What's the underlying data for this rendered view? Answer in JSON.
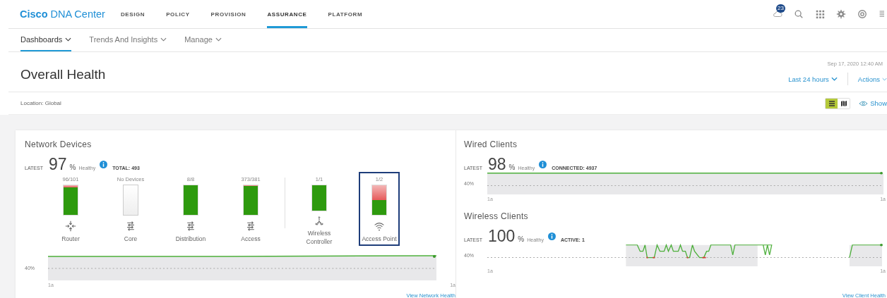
{
  "brand": {
    "bold": "Cisco",
    "rest": "DNA Center"
  },
  "nav": [
    {
      "label": "DESIGN",
      "selected": false
    },
    {
      "label": "POLICY",
      "selected": false
    },
    {
      "label": "PROVISION",
      "selected": false
    },
    {
      "label": "ASSURANCE",
      "selected": true
    },
    {
      "label": "PLATFORM",
      "selected": false
    }
  ],
  "notification_count": "23",
  "subnav": [
    {
      "label": "Dashboards",
      "selected": true
    },
    {
      "label": "Trends And Insights",
      "selected": false
    },
    {
      "label": "Manage",
      "selected": false
    }
  ],
  "page_title": "Overall Health",
  "timestamp": "Sep 17, 2020 12:40 AM",
  "time_range": "Last 24 hours",
  "actions": "Actions",
  "location": "Location: Global",
  "view_toggle": [
    {
      "kind": "list",
      "selected": true
    },
    {
      "kind": "map",
      "selected": false
    }
  ],
  "show_link": "Show",
  "network_devices": {
    "title": "Network Devices",
    "latest": "LATEST",
    "value": "97",
    "unit": "%",
    "healthy": "Healthy",
    "total": "TOTAL: 493",
    "devices": [
      {
        "name": "Router",
        "count": "96/101",
        "kind": "router",
        "level": 0.93,
        "highlighted": false,
        "separator_before": false
      },
      {
        "name": "Core",
        "count": "No Devices",
        "kind": "switch",
        "highlighted": false,
        "separator_before": false
      },
      {
        "name": "Distribution",
        "count": "8/8",
        "kind": "switch",
        "level": 1,
        "highlighted": false,
        "separator_before": false
      },
      {
        "name": "Access",
        "count": "373/381",
        "kind": "switch",
        "level": 0.97,
        "highlighted": false,
        "separator_before": false
      },
      {
        "name": "Wireless Controller",
        "count": "1/1",
        "kind": "controller",
        "level": 1,
        "highlighted": false,
        "separator_before": true
      },
      {
        "name": "Access Point",
        "count": "1/2",
        "kind": "wifi",
        "level": 0.5,
        "highlighted": true,
        "separator_before": false
      }
    ],
    "tick": "40%",
    "x_start": "1a",
    "x_end": "1a",
    "link": "View Network Health"
  },
  "wired_clients": {
    "title": "Wired Clients",
    "latest": "LATEST",
    "value": "98",
    "unit": "%",
    "healthy": "Healthy",
    "summary": "CONNECTED: 4937",
    "tick": "40%",
    "x_start": "1a",
    "x_end": "1a"
  },
  "wireless_clients": {
    "title": "Wireless Clients",
    "latest": "LATEST",
    "value": "100",
    "unit": "%",
    "healthy": "Healthy",
    "summary": "ACTIVE: 1",
    "tick": "40%",
    "x_start": "1a",
    "x_end": "1a",
    "link": "View Client Health"
  }
}
